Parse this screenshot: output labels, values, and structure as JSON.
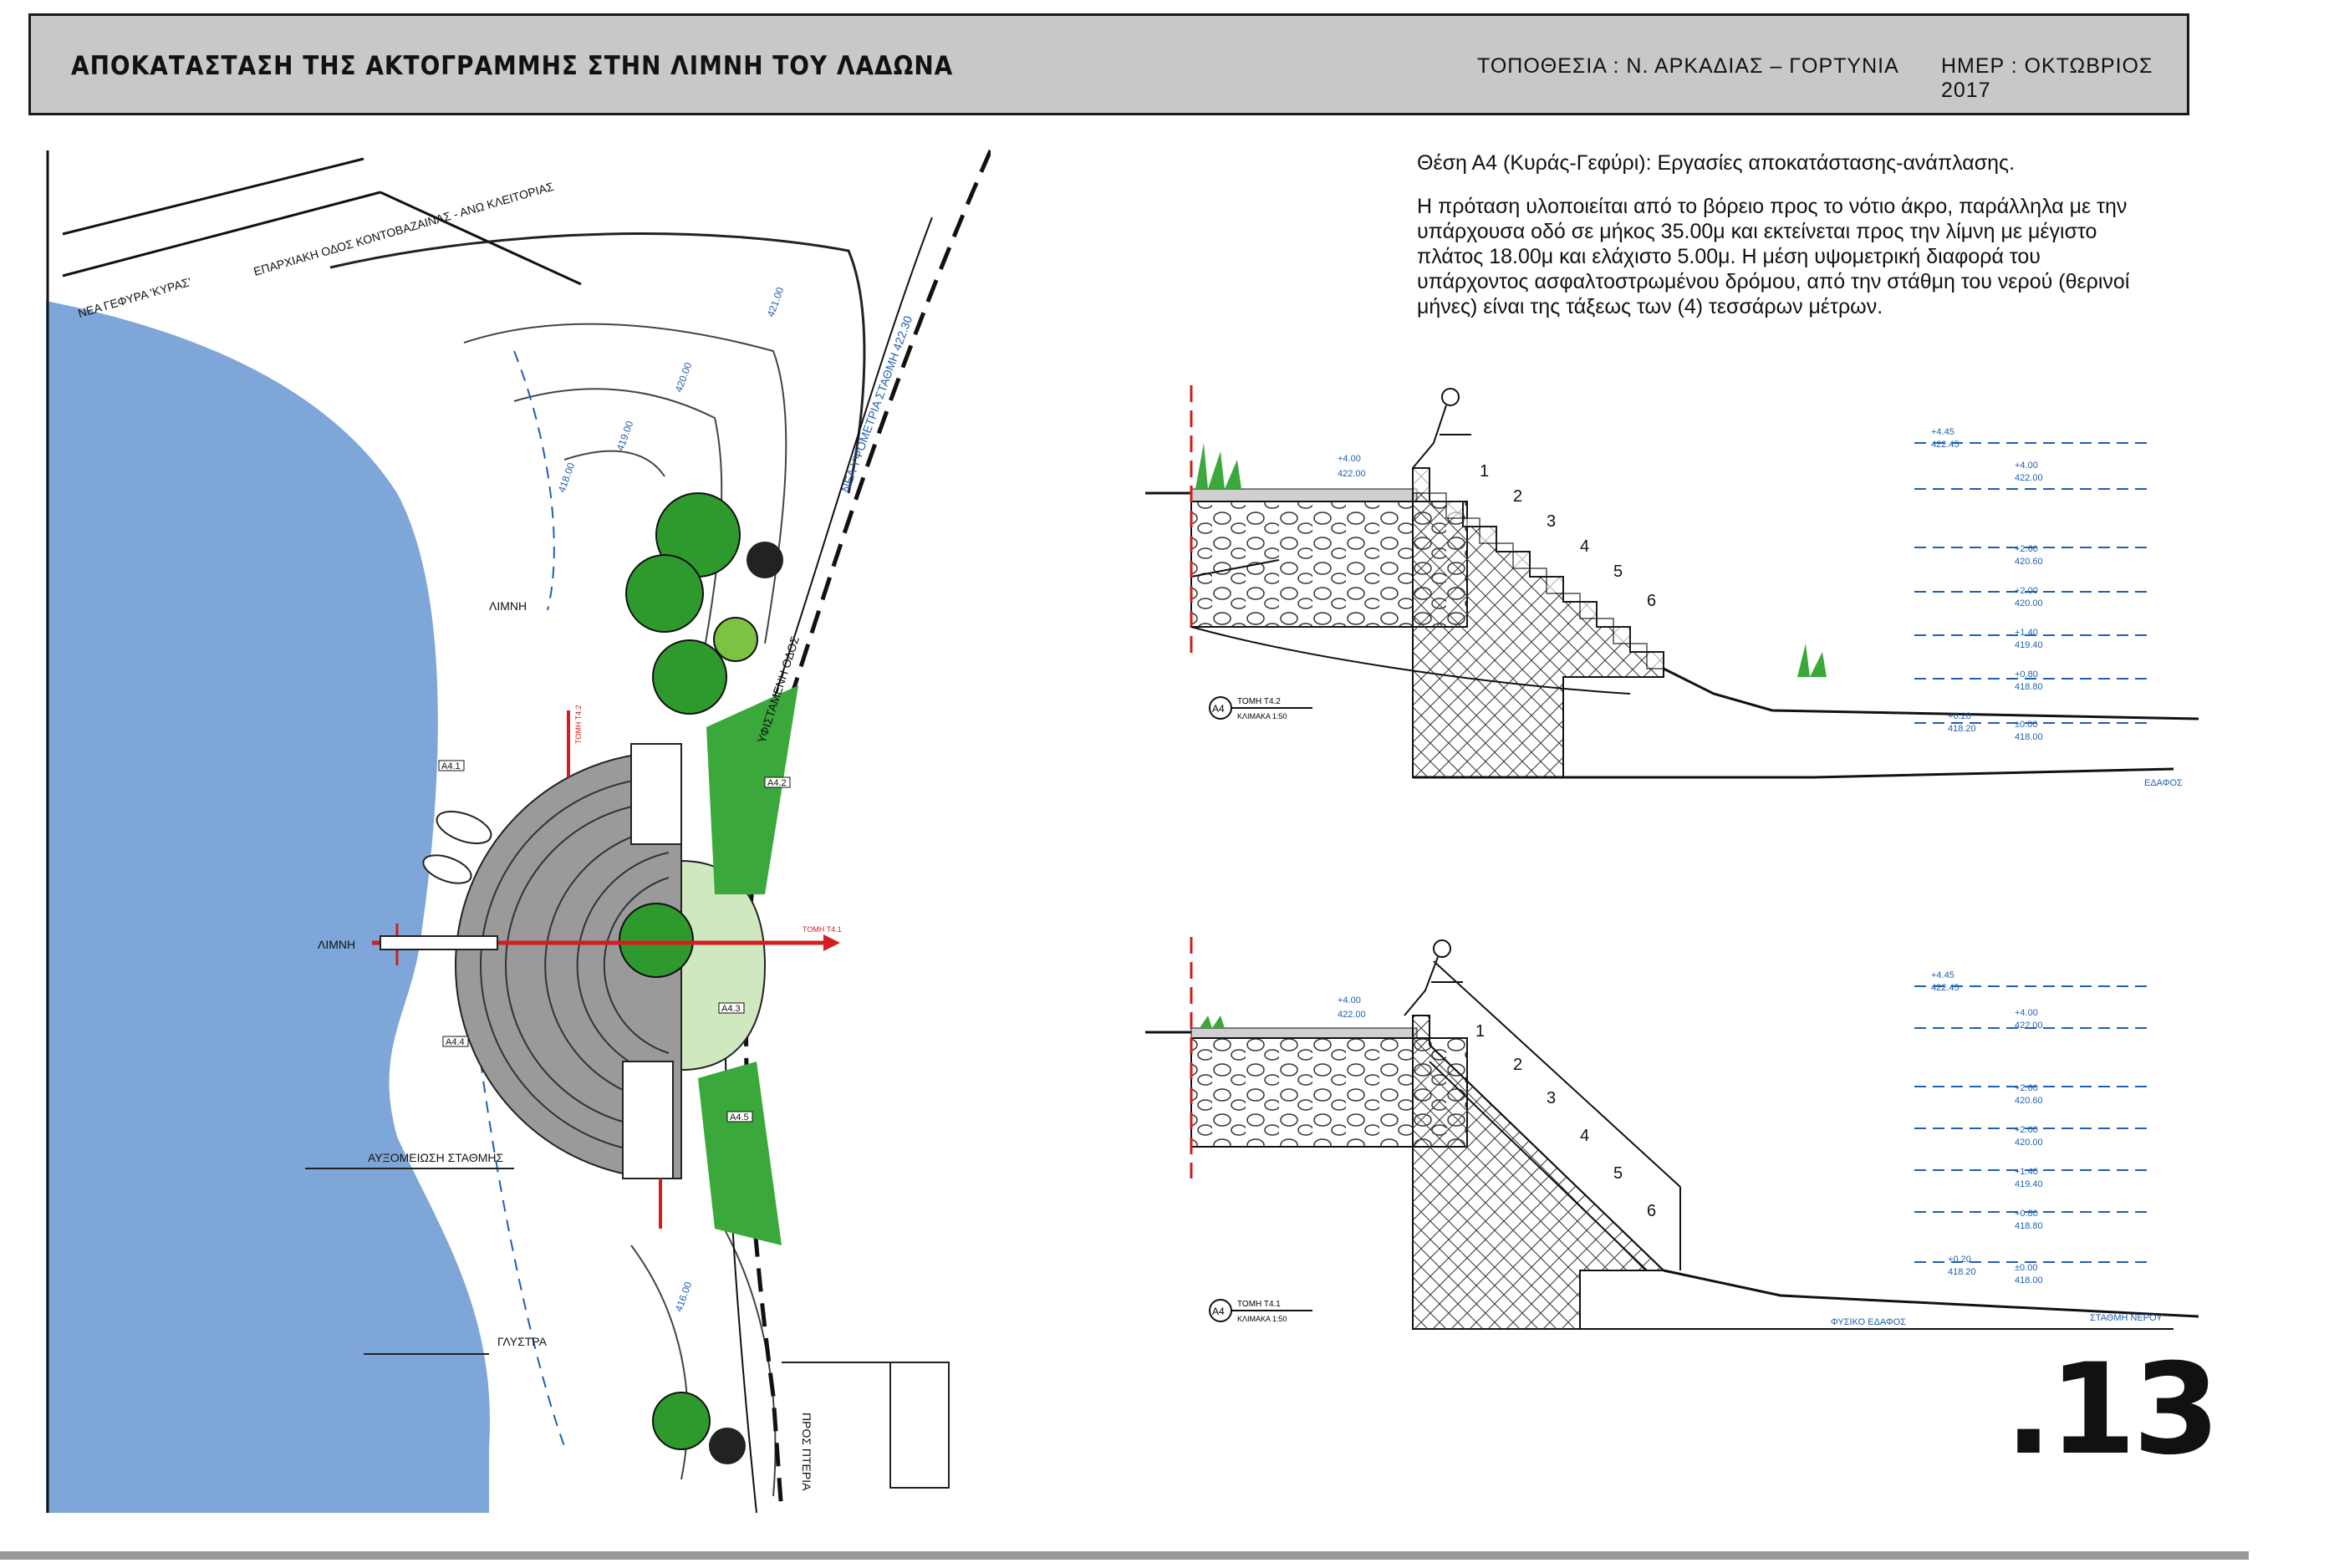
{
  "header": {
    "title": "ΑΠΟΚΑΤΑΣΤΑΣΗ ΤΗΣ ΑΚΤΟΓΡΑΜΜΗΣ ΣΤΗΝ ΛΙΜΝΗ ΤΟΥ ΛΑΔΩΝΑ",
    "location": "ΤΟΠΟΘΕΣΙΑ : Ν. ΑΡΚΑΔΙΑΣ – ΓΟΡΤΥΝΙΑ",
    "date": "ΗΜΕΡ : ΟΚΤΩΒΡΙΟΣ 2017"
  },
  "description": {
    "heading": "Θέση Α4 (Κυράς-Γεφύρι): Εργασίες αποκατάστασης-ανάπλασης.",
    "body": "Η πρόταση υλοποιείται από το βόρειο προς το νότιο άκρο, παράλληλα με την υπάρχουσα οδό σε μήκος 35.00μ και εκτείνεται προς την λίμνη με μέγιστο πλάτος 18.00μ και ελάχιστο 5.00μ. Η μέση υψομετρική διαφορά του υπάρχοντος ασφαλτοστρωμένου δρόμου, από την στάθμη του νερού (θερινοί μήνες) είναι της τάξεως των (4) τεσσάρων μέτρων."
  },
  "plan": {
    "labels": {
      "bridge": "ΝΕΑ ΓΕΦΥΡΑ 'ΚΥΡΑΣ'",
      "road": "ΕΠΑΡΧΙΑΚΗ ΟΔΟΣ ΚΟΝΤΟΒΑΖΑΙΝΑΣ - ΑΝΩ ΚΛΕΙΤΟΡΙΑΣ",
      "lake_upper": "ΛΙΜΝΗ",
      "lake_mid": "ΛΙΜΝΗ",
      "level_drop": "ΑΥΞΟΜΕΙΩΣΗ ΣΤΑΘΜΗΣ",
      "glystra": "ΓΛΥΣΤΡΑ",
      "to_pteria": "ΠΡΟΣ ΠΤΕΡΙΑ",
      "existing_road": "ΥΦΙΣΤΑΜΕΝΗ ΟΔΟΣ",
      "new_level": "ΝΕΑ ΥΨΟΜΕΤΡΙΑ ΣΤΑΘΜΗ 422.30",
      "section1": "ΤΟΜΗ Τ4.1",
      "section2": "ΤΟΜΗ Τ4.2",
      "box_A": "Α4.1",
      "box_B": "Α4.2",
      "box_C": "Α4.3",
      "box_D": "Α4.4",
      "box_E": "Α4.5"
    },
    "contours": [
      "421.00",
      "420.00",
      "419.00",
      "418.00",
      "416.00"
    ]
  },
  "sections": {
    "top": {
      "tag": "Α4",
      "name": "ΤΟΜΗ Τ4.2",
      "scale": "ΚΛΙΜΑΚΑ 1:50",
      "steps": [
        "1",
        "2",
        "3",
        "4",
        "5",
        "6"
      ],
      "levels": [
        {
          "rel": "+4.45",
          "abs": "422.45"
        },
        {
          "rel": "+4.00",
          "abs": "422.00"
        },
        {
          "rel": "+2.60",
          "abs": "420.60"
        },
        {
          "rel": "+2.00",
          "abs": "420.00"
        },
        {
          "rel": "+1.40",
          "abs": "419.40"
        },
        {
          "rel": "+0.80",
          "abs": "418.80"
        },
        {
          "rel": "+0.20",
          "abs": "418.20"
        },
        {
          "rel": "±0.00",
          "abs": "418.00"
        }
      ],
      "left_level": {
        "rel": "+4.00",
        "abs": "422.00"
      },
      "ground_label": "ΕΔΑΦΟΣ"
    },
    "bottom": {
      "tag": "Α4",
      "name": "ΤΟΜΗ Τ4.1",
      "scale": "ΚΛΙΜΑΚΑ 1:50",
      "steps": [
        "1",
        "2",
        "3",
        "4",
        "5",
        "6"
      ],
      "levels": [
        {
          "rel": "+4.45",
          "abs": "422.45"
        },
        {
          "rel": "+4.00",
          "abs": "422.00"
        },
        {
          "rel": "+2.60",
          "abs": "420.60"
        },
        {
          "rel": "+2.00",
          "abs": "420.00"
        },
        {
          "rel": "+1.40",
          "abs": "419.40"
        },
        {
          "rel": "+0.80",
          "abs": "418.80"
        },
        {
          "rel": "+0.20",
          "abs": "418.20"
        },
        {
          "rel": "±0.00",
          "abs": "418.00"
        }
      ],
      "left_level": {
        "rel": "+4.00",
        "abs": "422.00"
      },
      "ground_label": "ΦΥΣΙΚΟ ΕΔΑΦΟΣ",
      "water_label": "ΣΤΑΘΜΗ ΝΕΡΟΥ"
    }
  },
  "page_number": ".13",
  "colors": {
    "title_bg": "#c8c8c8",
    "water": "#7fa6d8",
    "tree": "#2e9a2e",
    "grass": "#3aa83a",
    "paving": "#9a9a9a",
    "section_line": "#d21e1e",
    "annotation": "#1f5fb4"
  }
}
